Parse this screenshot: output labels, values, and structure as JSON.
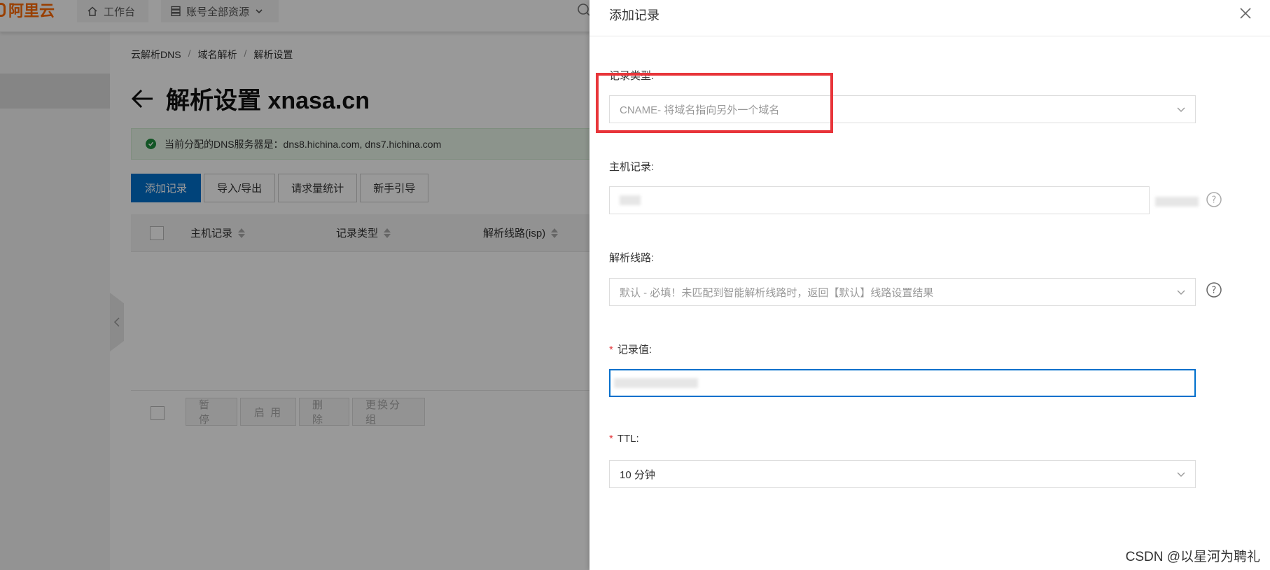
{
  "topbar": {
    "logo_text": "阿里云",
    "nav_workbench": "工作台",
    "nav_resources": "账号全部资源"
  },
  "breadcrumb": [
    "云解析DNS",
    "域名解析",
    "解析设置"
  ],
  "page_title": "解析设置 xnasa.cn",
  "dns_alert": "当前分配的DNS服务器是：dns8.hichina.com, dns7.hichina.com",
  "actions": [
    "添加记录",
    "导入/导出",
    "请求量统计",
    "新手引导"
  ],
  "table": {
    "columns": [
      "主机记录",
      "记录类型",
      "解析线路(isp)"
    ]
  },
  "footer_actions": [
    "暂 停",
    "启 用",
    "删 除",
    "更换分组"
  ],
  "drawer": {
    "title": "添加记录",
    "record_type": {
      "label": "记录类型:",
      "value": "CNAME- 将域名指向另外一个域名"
    },
    "host_record": {
      "label": "主机记录:"
    },
    "line": {
      "label": "解析线路:",
      "value": "默认 - 必填！未匹配到智能解析线路时，返回【默认】线路设置结果"
    },
    "record_value": {
      "label": "记录值:"
    },
    "ttl": {
      "label": "TTL:",
      "value": "10 分钟"
    }
  },
  "watermark": "CSDN @以星河为聘礼",
  "colors": {
    "primary": "#0070cc",
    "brand": "#ff6a00",
    "highlight": "#e8353a",
    "required": "#e4393c",
    "success": "#1e8e3e"
  }
}
